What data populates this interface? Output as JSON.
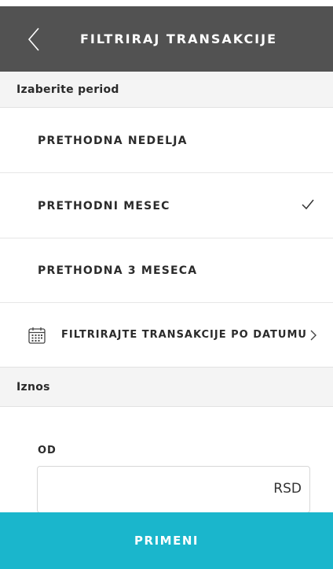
{
  "header": {
    "title": "FILTRIRAJ TRANSAKCIJE",
    "back_icon": "chevron-left-icon"
  },
  "period_section": {
    "title": "Izaberite period",
    "options": [
      {
        "label": "PRETHODNA NEDELJA",
        "selected": false
      },
      {
        "label": "PRETHODNI MESEC",
        "selected": true
      },
      {
        "label": "PRETHODNA 3 MESECA",
        "selected": false
      }
    ],
    "date_filter": {
      "label": "FILTRIRAJTE TRANSAKCIJE PO DATUMU",
      "icon": "calendar-icon"
    }
  },
  "amount_section": {
    "title": "Iznos",
    "from_label": "OD",
    "from_value": "",
    "currency": "RSD"
  },
  "apply_label": "PRIMENI",
  "colors": {
    "header_bg": "#525252",
    "accent": "#1ab6cc",
    "section_bg": "#f4f4f4"
  }
}
